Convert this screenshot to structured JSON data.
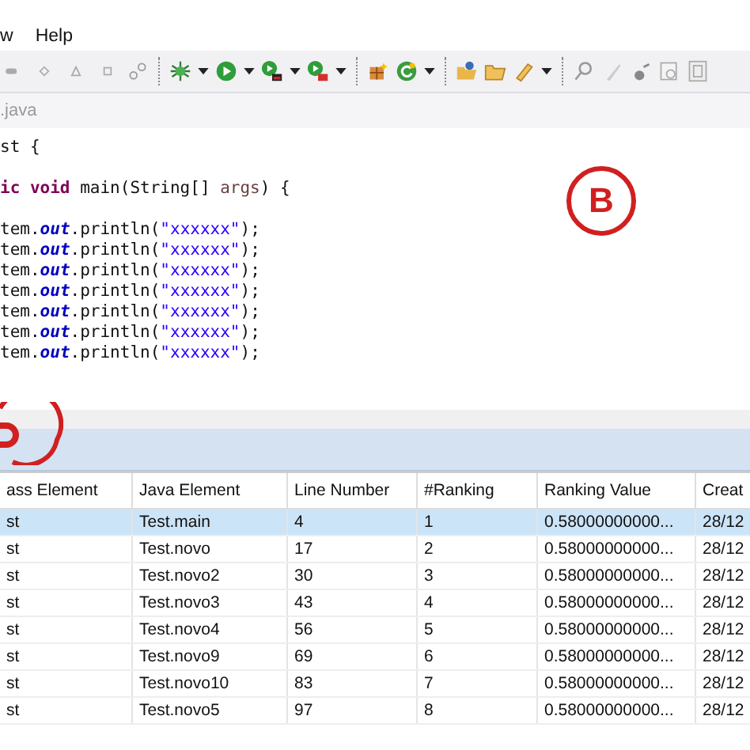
{
  "menu_bar": {
    "items": [
      "w",
      "Help"
    ]
  },
  "editor_tab": {
    "title": ".java"
  },
  "editor": {
    "lines": [
      {
        "kind": "code",
        "segments": [
          {
            "kind": "plain",
            "text": "st {"
          }
        ]
      },
      {
        "kind": "blank"
      },
      {
        "kind": "code",
        "segments": [
          {
            "kind": "keyword",
            "text": "ic void"
          },
          {
            "kind": "plain",
            "text": " main(String[] "
          },
          {
            "kind": "param",
            "text": "args"
          },
          {
            "kind": "plain",
            "text": ") {"
          }
        ]
      },
      {
        "kind": "blank"
      },
      {
        "kind": "code",
        "segments": [
          {
            "kind": "plain",
            "text": "tem."
          },
          {
            "kind": "field",
            "text": "out"
          },
          {
            "kind": "plain",
            "text": ".println("
          },
          {
            "kind": "string",
            "text": "\"xxxxxx\""
          },
          {
            "kind": "plain",
            "text": ");"
          }
        ]
      },
      {
        "kind": "code",
        "segments": [
          {
            "kind": "plain",
            "text": "tem."
          },
          {
            "kind": "field",
            "text": "out"
          },
          {
            "kind": "plain",
            "text": ".println("
          },
          {
            "kind": "string",
            "text": "\"xxxxxx\""
          },
          {
            "kind": "plain",
            "text": ");"
          }
        ]
      },
      {
        "kind": "code",
        "segments": [
          {
            "kind": "plain",
            "text": "tem."
          },
          {
            "kind": "field",
            "text": "out"
          },
          {
            "kind": "plain",
            "text": ".println("
          },
          {
            "kind": "string",
            "text": "\"xxxxxx\""
          },
          {
            "kind": "plain",
            "text": ");"
          }
        ]
      },
      {
        "kind": "code",
        "segments": [
          {
            "kind": "plain",
            "text": "tem."
          },
          {
            "kind": "field",
            "text": "out"
          },
          {
            "kind": "plain",
            "text": ".println("
          },
          {
            "kind": "string",
            "text": "\"xxxxxx\""
          },
          {
            "kind": "plain",
            "text": ");"
          }
        ]
      },
      {
        "kind": "code",
        "segments": [
          {
            "kind": "plain",
            "text": "tem."
          },
          {
            "kind": "field",
            "text": "out"
          },
          {
            "kind": "plain",
            "text": ".println("
          },
          {
            "kind": "string",
            "text": "\"xxxxxx\""
          },
          {
            "kind": "plain",
            "text": ");"
          }
        ]
      },
      {
        "kind": "code",
        "segments": [
          {
            "kind": "plain",
            "text": "tem."
          },
          {
            "kind": "field",
            "text": "out"
          },
          {
            "kind": "plain",
            "text": ".println("
          },
          {
            "kind": "string",
            "text": "\"xxxxxx\""
          },
          {
            "kind": "plain",
            "text": ");"
          }
        ]
      },
      {
        "kind": "code",
        "segments": [
          {
            "kind": "plain",
            "text": "tem."
          },
          {
            "kind": "field",
            "text": "out"
          },
          {
            "kind": "plain",
            "text": ".println("
          },
          {
            "kind": "string",
            "text": "\"xxxxxx\""
          },
          {
            "kind": "plain",
            "text": ");"
          }
        ]
      }
    ]
  },
  "annotation": {
    "label": "B"
  },
  "table": {
    "columns": [
      "ass Element",
      "Java Element",
      "Line Number",
      "#Ranking",
      "Ranking Value",
      "Creat"
    ],
    "rows": [
      {
        "selected": true,
        "cells": [
          "st",
          "Test.main",
          "4",
          "1",
          "0.58000000000...",
          "28/12"
        ]
      },
      {
        "selected": false,
        "cells": [
          "st",
          "Test.novo",
          "17",
          "2",
          "0.58000000000...",
          "28/12"
        ]
      },
      {
        "selected": false,
        "cells": [
          "st",
          "Test.novo2",
          "30",
          "3",
          "0.58000000000...",
          "28/12"
        ]
      },
      {
        "selected": false,
        "cells": [
          "st",
          "Test.novo3",
          "43",
          "4",
          "0.58000000000...",
          "28/12"
        ]
      },
      {
        "selected": false,
        "cells": [
          "st",
          "Test.novo4",
          "56",
          "5",
          "0.58000000000...",
          "28/12"
        ]
      },
      {
        "selected": false,
        "cells": [
          "st",
          "Test.novo9",
          "69",
          "6",
          "0.58000000000...",
          "28/12"
        ]
      },
      {
        "selected": false,
        "cells": [
          "st",
          "Test.novo10",
          "83",
          "7",
          "0.58000000000...",
          "28/12"
        ]
      },
      {
        "selected": false,
        "cells": [
          "st",
          "Test.novo5",
          "97",
          "8",
          "0.58000000000...",
          "28/12"
        ]
      }
    ]
  }
}
